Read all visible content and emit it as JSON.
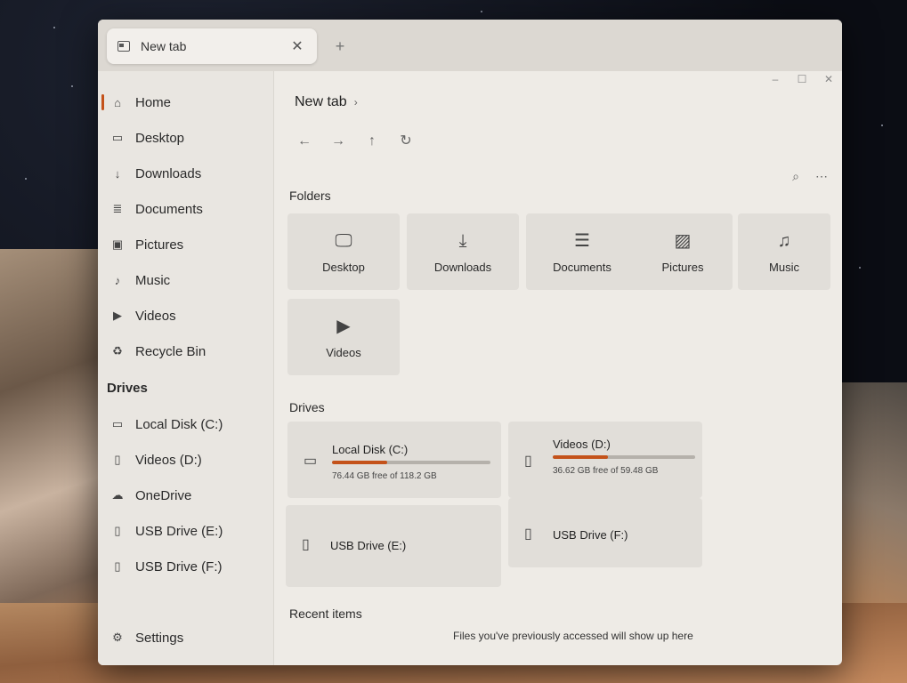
{
  "theme": {
    "accent": "#c4521a"
  },
  "tab": {
    "label": "New tab",
    "icon": "browser-tab-icon",
    "close": "✕"
  },
  "titlebar": {
    "new_tab": "+",
    "minimize": "–",
    "maximize": "☐",
    "close": "✕"
  },
  "sidebar": {
    "items": [
      {
        "label": "Home",
        "icon": "home-icon"
      },
      {
        "label": "Desktop",
        "icon": "monitor-icon"
      },
      {
        "label": "Downloads",
        "icon": "download-icon"
      },
      {
        "label": "Documents",
        "icon": "document-icon"
      },
      {
        "label": "Pictures",
        "icon": "image-icon"
      },
      {
        "label": "Music",
        "icon": "music-note-icon"
      },
      {
        "label": "Videos",
        "icon": "video-icon"
      },
      {
        "label": "Recycle Bin",
        "icon": "recycle-bin-icon"
      }
    ],
    "drives_heading": "Drives",
    "drives": [
      {
        "label": "Local Disk (C:)",
        "icon": "hard-drive-icon"
      },
      {
        "label": "Videos (D:)",
        "icon": "usb-drive-icon"
      },
      {
        "label": "OneDrive",
        "icon": "cloud-icon"
      },
      {
        "label": "USB Drive (E:)",
        "icon": "usb-drive-icon"
      },
      {
        "label": "USB Drive (F:)",
        "icon": "usb-drive-icon"
      }
    ],
    "settings": {
      "label": "Settings",
      "icon": "gear-icon"
    }
  },
  "main": {
    "breadcrumb": "New tab",
    "folders_heading": "Folders",
    "folders": [
      {
        "label": "Desktop",
        "icon": "monitor-icon"
      },
      {
        "label": "Downloads",
        "icon": "download-icon"
      },
      {
        "label": "Documents",
        "icon": "document-icon"
      },
      {
        "label": "Pictures",
        "icon": "image-icon"
      },
      {
        "label": "Music",
        "icon": "music-note-icon"
      },
      {
        "label": "Videos",
        "icon": "video-icon"
      }
    ],
    "drives_heading": "Drives",
    "drives": [
      {
        "label": "Local Disk (C:)",
        "free": "76.44 GB free of 118.2 GB",
        "used_fraction": 0.35
      },
      {
        "label": "Videos (D:)",
        "free": "36.62 GB free of 59.48 GB",
        "used_fraction": 0.39
      },
      {
        "label": "USB Drive (E:)"
      },
      {
        "label": "USB Drive (F:)"
      }
    ],
    "recent_heading": "Recent items",
    "recent_empty": "Files you've previously accessed will show up here"
  }
}
